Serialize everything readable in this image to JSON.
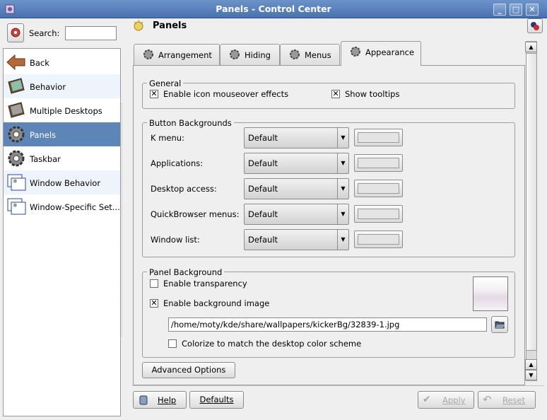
{
  "window": {
    "title": "Panels - Control Center",
    "minimize": "_",
    "maximize": "□",
    "close": "✕"
  },
  "search": {
    "label": "Search:",
    "value": ""
  },
  "sidebar": {
    "items": [
      {
        "label": "Back",
        "icon": "back-arrow-icon"
      },
      {
        "label": "Behavior",
        "icon": "monitor-icon"
      },
      {
        "label": "Multiple Desktops",
        "icon": "monitor-icon"
      },
      {
        "label": "Panels",
        "icon": "gear-icon"
      },
      {
        "label": "Taskbar",
        "icon": "gear-icon"
      },
      {
        "label": "Window Behavior",
        "icon": "window-icon"
      },
      {
        "label": "Window-Specific Set...",
        "icon": "window-icon"
      }
    ]
  },
  "header": {
    "title": "Panels"
  },
  "tabs": [
    {
      "label": "Arrangement"
    },
    {
      "label": "Hiding"
    },
    {
      "label": "Menus"
    },
    {
      "label": "Appearance",
      "active": true
    }
  ],
  "general": {
    "title": "General",
    "mouseover": {
      "label": "Enable icon mouseover effects",
      "checked": true
    },
    "tooltips": {
      "label": "Show tooltips",
      "checked": true
    }
  },
  "button_backgrounds": {
    "title": "Button Backgrounds",
    "rows": [
      {
        "label": "K menu:",
        "value": "Default"
      },
      {
        "label": "Applications:",
        "value": "Default"
      },
      {
        "label": "Desktop access:",
        "value": "Default"
      },
      {
        "label": "QuickBrowser menus:",
        "value": "Default"
      },
      {
        "label": "Window list:",
        "value": "Default"
      }
    ]
  },
  "panel_background": {
    "title": "Panel Background",
    "transparency": {
      "label": "Enable transparency",
      "checked": false
    },
    "background_image": {
      "label": "Enable background image",
      "checked": true
    },
    "path": "/home/moty/kde/share/wallpapers/kickerBg/32839-1.jpg",
    "colorize": {
      "label": "Colorize to match the desktop color scheme",
      "checked": false
    }
  },
  "advanced_label": "Advanced Options",
  "footer": {
    "help": "Help",
    "defaults": "Defaults",
    "apply": "Apply",
    "reset": "Reset"
  },
  "colors": {
    "title_bar": "#5b82bd",
    "selection": "#5d85b8",
    "background": "#efefef"
  }
}
